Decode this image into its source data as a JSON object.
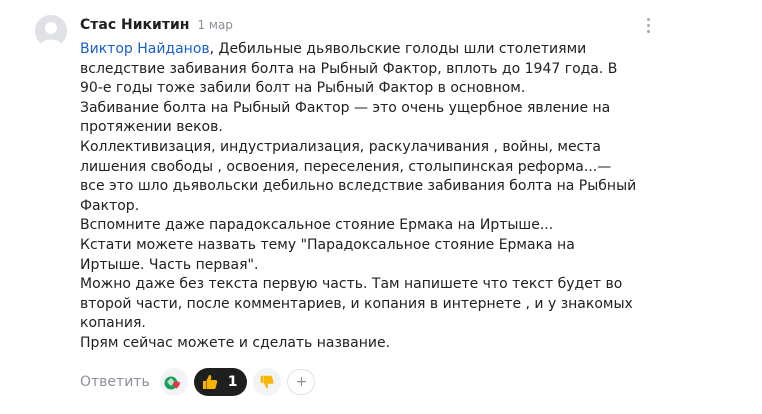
{
  "comment": {
    "author": "Стас Никитин",
    "date": "1 мар",
    "mention": "Виктор Найданов",
    "lines": [
      ", Дебильные дьявольские голоды шли столетиями вследствие забивания болта на Рыбный Фактор, вплоть до 1947 года. В 90-е годы тоже забили болт на Рыбный Фактор в основном.",
      "Забивание болта на Рыбный Фактор — это очень ущербное явление на протяжении веков.",
      "Коллективизация, индустриализация, раскулачивания , войны, места лишения свободы , освоения, переселения, столыпинская реформа...— все это шло дьявольски дебильно вследствие забивания болта на Рыбный Фактор.",
      "Вспомните даже парадоксальное стояние Ермака на Иртыше...",
      "Кстати можете назвать тему \"Парадоксальное стояние Ермака на Иртыше. Часть первая\".",
      "Можно даже без текста первую часть. Там напишете что текст будет во второй части, после комментариев, и копания в интернете , и у знакомых копания.",
      "Прям сейчас можете и сделать название."
    ]
  },
  "actions": {
    "reply_label": "Ответить",
    "like_count": "1",
    "add_glyph": "+"
  },
  "icons": {
    "reactions_stack": "reaction-stack-icon",
    "thumbs_up": "thumbs-up-icon",
    "thumbs_down": "thumbs-down-icon",
    "more": "more-vertical-icon"
  },
  "colors": {
    "mention": "#1a5fd0",
    "muted": "#8a8f98",
    "active_reaction_bg": "#1f1f1f",
    "reaction_bg": "#f2f3f5",
    "thumb_yellow": "#f7b500"
  }
}
